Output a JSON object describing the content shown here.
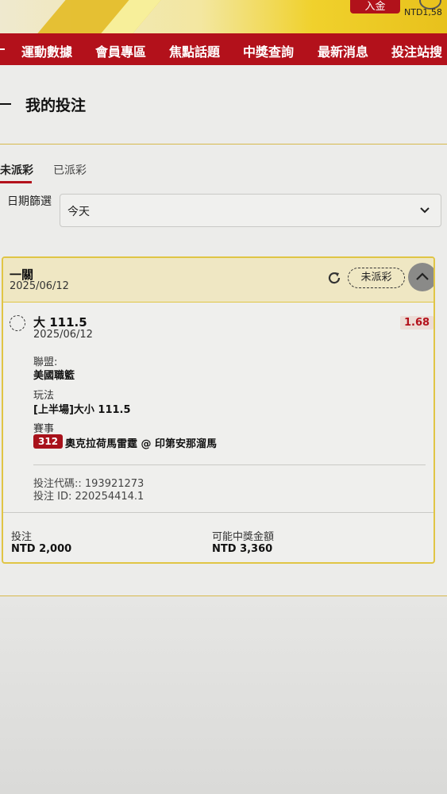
{
  "header": {
    "deposit_label": "入金",
    "balance": "NTD1,58"
  },
  "nav": {
    "items": [
      "運動數據",
      "會員專區",
      "焦點話題",
      "中獎查詢",
      "最新消息",
      "投注站搜"
    ]
  },
  "page": {
    "title": "我的投注"
  },
  "tabs": {
    "active": "未派彩",
    "inactive": "已派彩"
  },
  "filter": {
    "label": "日期篩選",
    "selected": "今天"
  },
  "bet": {
    "type": "一關",
    "date": "2025/06/12",
    "status": "未派彩",
    "selection": "大 111.5",
    "selection_date": "2025/06/12",
    "odds": "1.68",
    "league_label": "聯盟:",
    "league": "美國職籃",
    "market_label": "玩法",
    "market": "[上半場]大小 111.5",
    "event_label": "賽事",
    "event_number": "312",
    "event_name": "奧克拉荷馬雷霆 @ 印第安那溜馬",
    "bet_code": "投注代碼:: 193921273",
    "bet_id": "投注 ID: 220254414.1",
    "stake_label": "投注",
    "stake": "NTD 2,000",
    "payout_label": "可能中獎金額",
    "payout": "NTD 3,360"
  }
}
